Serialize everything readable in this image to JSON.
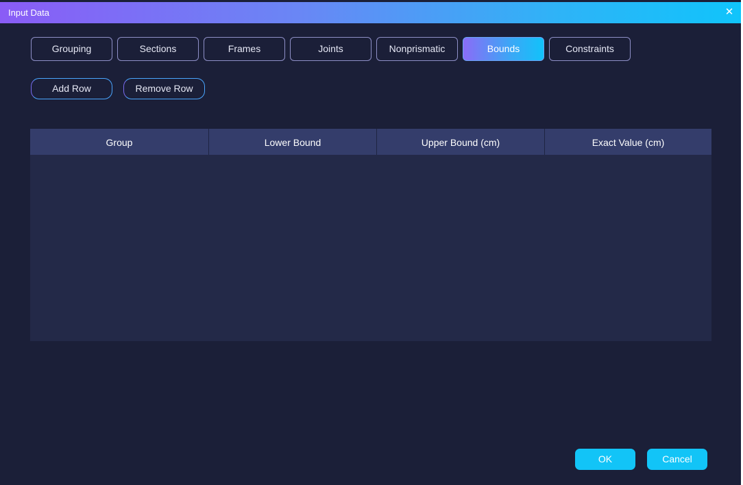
{
  "window": {
    "title": "Input Data",
    "close_icon": "close-icon",
    "accent_gradient": [
      "#8a5cf6",
      "#10c4fb"
    ],
    "background": "#1b1f38"
  },
  "tabs": [
    {
      "label": "Grouping",
      "active": false
    },
    {
      "label": "Sections",
      "active": false
    },
    {
      "label": "Frames",
      "active": false
    },
    {
      "label": "Joints",
      "active": false
    },
    {
      "label": "Nonprismatic",
      "active": false
    },
    {
      "label": "Bounds",
      "active": true
    },
    {
      "label": "Constraints",
      "active": false
    }
  ],
  "toolbar": {
    "add_row_label": "Add Row",
    "remove_row_label": "Remove Row"
  },
  "table": {
    "columns": [
      "Group",
      "Lower Bound",
      "Upper Bound (cm)",
      "Exact Value (cm)"
    ],
    "rows": []
  },
  "footer": {
    "ok_label": "OK",
    "cancel_label": "Cancel"
  }
}
